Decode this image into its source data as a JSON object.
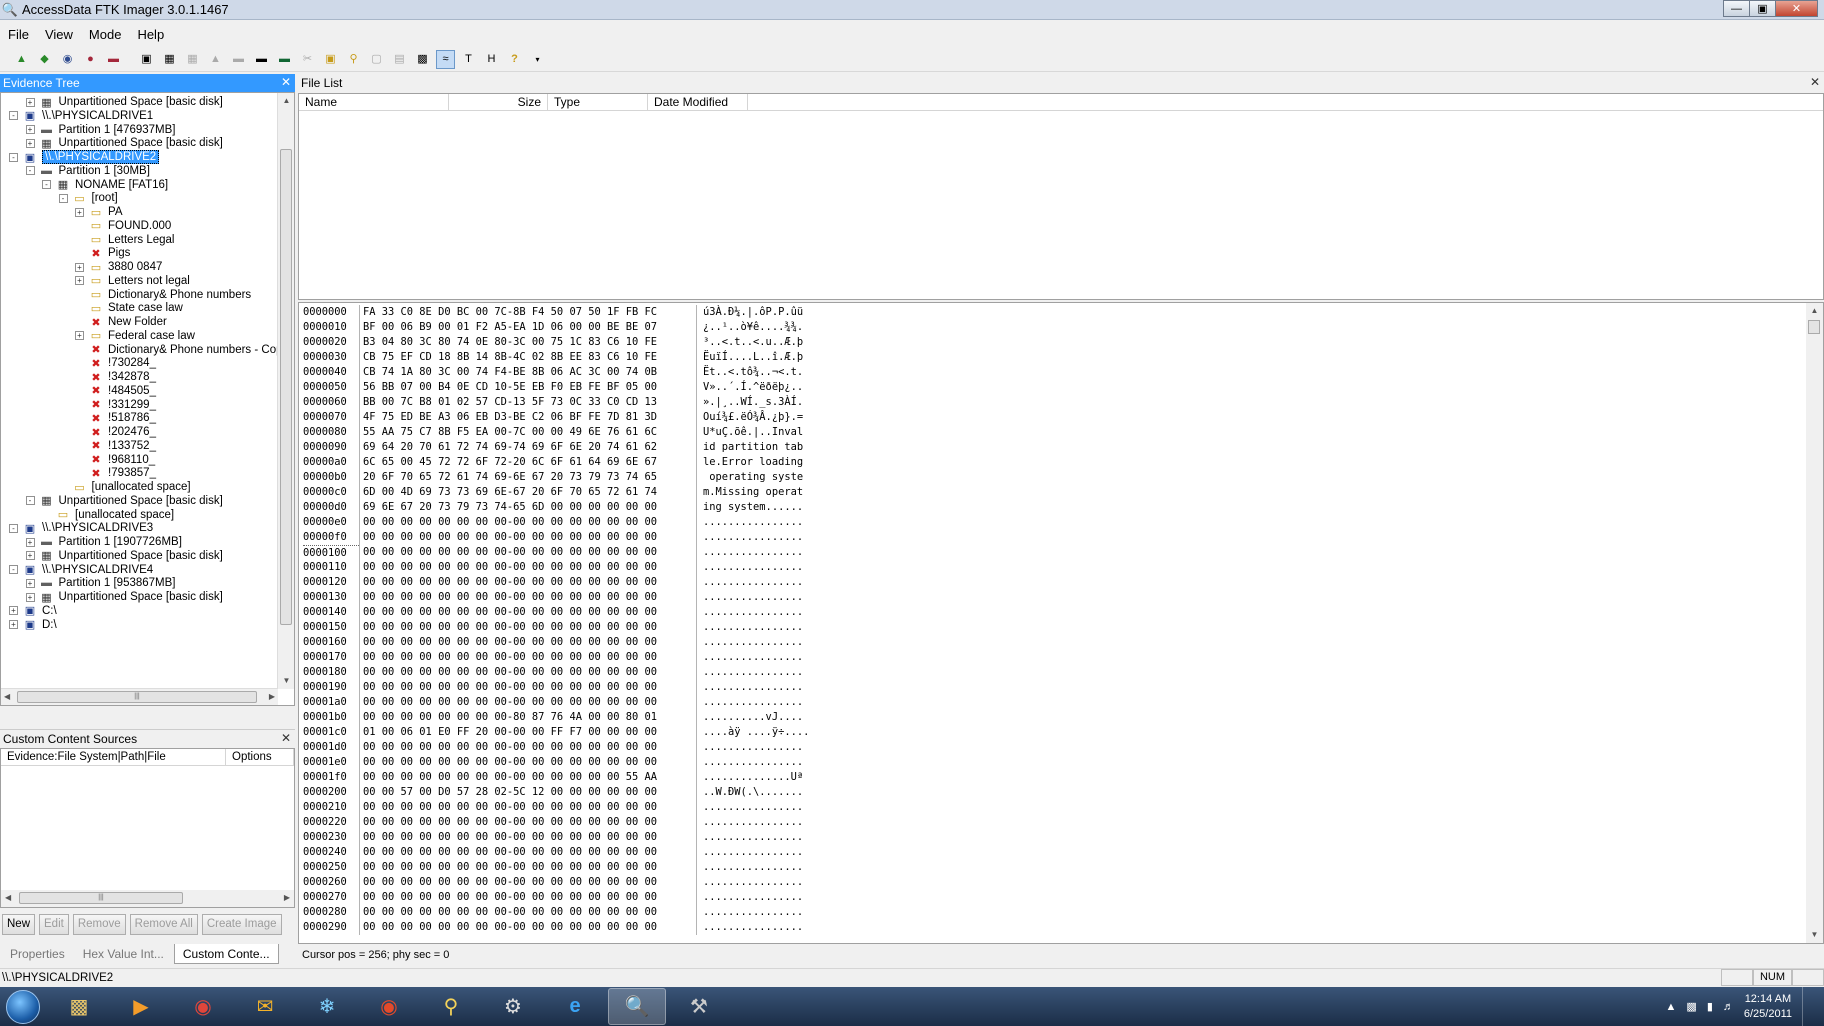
{
  "window": {
    "title": "AccessData FTK Imager 3.0.1.1467"
  },
  "menu": [
    "File",
    "View",
    "Mode",
    "Help"
  ],
  "panels": {
    "evidence_tree": "Evidence Tree",
    "file_list": "File List",
    "custom_content": "Custom Content Sources"
  },
  "tree": [
    {
      "level": 1,
      "exp": "+",
      "icon": "fs",
      "label": "Unpartitioned Space [basic disk]"
    },
    {
      "level": 0,
      "exp": "-",
      "icon": "drive",
      "label": "\\\\.\\PHYSICALDRIVE1"
    },
    {
      "level": 1,
      "exp": "+",
      "icon": "part",
      "label": "Partition 1 [476937MB]"
    },
    {
      "level": 1,
      "exp": "+",
      "icon": "fs",
      "label": "Unpartitioned Space [basic disk]"
    },
    {
      "level": 0,
      "exp": "-",
      "icon": "drive",
      "label": "\\\\.\\PHYSICALDRIVE2",
      "selected": true
    },
    {
      "level": 1,
      "exp": "-",
      "icon": "part",
      "label": "Partition 1 [30MB]"
    },
    {
      "level": 2,
      "exp": "-",
      "icon": "fs",
      "label": "NONAME [FAT16]"
    },
    {
      "level": 3,
      "exp": "-",
      "icon": "folder",
      "label": "[root]"
    },
    {
      "level": 4,
      "exp": "+",
      "icon": "folder",
      "label": "PA"
    },
    {
      "level": 4,
      "exp": "",
      "icon": "folder",
      "label": "FOUND.000"
    },
    {
      "level": 4,
      "exp": "",
      "icon": "folder",
      "label": "Letters Legal"
    },
    {
      "level": 4,
      "exp": "",
      "icon": "del",
      "label": "Pigs"
    },
    {
      "level": 4,
      "exp": "+",
      "icon": "folder",
      "label": "3880   0847"
    },
    {
      "level": 4,
      "exp": "+",
      "icon": "folder",
      "label": "Letters not legal"
    },
    {
      "level": 4,
      "exp": "",
      "icon": "folder",
      "label": "Dictionary& Phone numbers"
    },
    {
      "level": 4,
      "exp": "",
      "icon": "folder",
      "label": "State case law"
    },
    {
      "level": 4,
      "exp": "",
      "icon": "del",
      "label": "New Folder"
    },
    {
      "level": 4,
      "exp": "+",
      "icon": "folder",
      "label": "Federal case law"
    },
    {
      "level": 4,
      "exp": "",
      "icon": "del",
      "label": "Dictionary& Phone numbers - Copy"
    },
    {
      "level": 4,
      "exp": "",
      "icon": "del",
      "label": "!730284_"
    },
    {
      "level": 4,
      "exp": "",
      "icon": "del",
      "label": "!342878_"
    },
    {
      "level": 4,
      "exp": "",
      "icon": "del",
      "label": "!484505_"
    },
    {
      "level": 4,
      "exp": "",
      "icon": "del",
      "label": "!331299_"
    },
    {
      "level": 4,
      "exp": "",
      "icon": "del",
      "label": "!518786_"
    },
    {
      "level": 4,
      "exp": "",
      "icon": "del",
      "label": "!202476_"
    },
    {
      "level": 4,
      "exp": "",
      "icon": "del",
      "label": "!133752_"
    },
    {
      "level": 4,
      "exp": "",
      "icon": "del",
      "label": "!968110_"
    },
    {
      "level": 4,
      "exp": "",
      "icon": "del",
      "label": "!793857_"
    },
    {
      "level": 3,
      "exp": "",
      "icon": "folder",
      "label": "[unallocated space]"
    },
    {
      "level": 1,
      "exp": "-",
      "icon": "fs",
      "label": "Unpartitioned Space [basic disk]"
    },
    {
      "level": 2,
      "exp": "",
      "icon": "folder",
      "label": "[unallocated space]"
    },
    {
      "level": 0,
      "exp": "-",
      "icon": "drive",
      "label": "\\\\.\\PHYSICALDRIVE3"
    },
    {
      "level": 1,
      "exp": "+",
      "icon": "part",
      "label": "Partition 1 [1907726MB]"
    },
    {
      "level": 1,
      "exp": "+",
      "icon": "fs",
      "label": "Unpartitioned Space [basic disk]"
    },
    {
      "level": 0,
      "exp": "-",
      "icon": "drive",
      "label": "\\\\.\\PHYSICALDRIVE4"
    },
    {
      "level": 1,
      "exp": "+",
      "icon": "part",
      "label": "Partition 1 [953867MB]"
    },
    {
      "level": 1,
      "exp": "+",
      "icon": "fs",
      "label": "Unpartitioned Space [basic disk]"
    },
    {
      "level": 0,
      "exp": "+",
      "icon": "drive",
      "label": "C:\\"
    },
    {
      "level": 0,
      "exp": "+",
      "icon": "drive",
      "label": "D:\\"
    }
  ],
  "file_list_columns": [
    "Name",
    "Size",
    "Type",
    "Date Modified"
  ],
  "custom_content_columns": [
    "Evidence:File System|Path|File",
    "Options"
  ],
  "custom_buttons": [
    {
      "label": "New",
      "enabled": true
    },
    {
      "label": "Edit",
      "enabled": false
    },
    {
      "label": "Remove",
      "enabled": false
    },
    {
      "label": "Remove All",
      "enabled": false
    },
    {
      "label": "Create Image",
      "enabled": false
    }
  ],
  "bottom_tabs": [
    {
      "label": "Properties",
      "active": false
    },
    {
      "label": "Hex Value Int...",
      "active": false
    },
    {
      "label": "Custom Conte...",
      "active": true
    }
  ],
  "hex": [
    {
      "off": "0000000",
      "hex": "FA 33 C0 8E D0 BC 00 7C-8B F4 50 07 50 1F FB FC",
      "ascii": "ú3À.Ð¼.|.ôP.P.ûü"
    },
    {
      "off": "0000010",
      "hex": "BF 00 06 B9 00 01 F2 A5-EA 1D 06 00 00 BE BE 07",
      "ascii": "¿..¹..ò¥ê....¾¾."
    },
    {
      "off": "0000020",
      "hex": "B3 04 80 3C 80 74 0E 80-3C 00 75 1C 83 C6 10 FE",
      "ascii": "³..<.t..<.u..Æ.þ"
    },
    {
      "off": "0000030",
      "hex": "CB 75 EF CD 18 8B 14 8B-4C 02 8B EE 83 C6 10 FE",
      "ascii": "ËuïÍ....L..î.Æ.þ"
    },
    {
      "off": "0000040",
      "hex": "CB 74 1A 80 3C 00 74 F4-BE 8B 06 AC 3C 00 74 0B",
      "ascii": "Ët..<.tô¾..¬<.t."
    },
    {
      "off": "0000050",
      "hex": "56 BB 07 00 B4 0E CD 10-5E EB F0 EB FE BF 05 00",
      "ascii": "V»..´.Í.^ëðëþ¿.."
    },
    {
      "off": "0000060",
      "hex": "BB 00 7C B8 01 02 57 CD-13 5F 73 0C 33 C0 CD 13",
      "ascii": "».|¸..WÍ._s.3ÀÍ."
    },
    {
      "off": "0000070",
      "hex": "4F 75 ED BE A3 06 EB D3-BE C2 06 BF FE 7D 81 3D",
      "ascii": "Ouí¾£.ëÓ¾Â.¿þ}.="
    },
    {
      "off": "0000080",
      "hex": "55 AA 75 C7 8B F5 EA 00-7C 00 00 49 6E 76 61 6C",
      "ascii": "U*uÇ.õê.|..Inval"
    },
    {
      "off": "0000090",
      "hex": "69 64 20 70 61 72 74 69-74 69 6F 6E 20 74 61 62",
      "ascii": "id partition tab"
    },
    {
      "off": "00000a0",
      "hex": "6C 65 00 45 72 72 6F 72-20 6C 6F 61 64 69 6E 67",
      "ascii": "le.Error loading"
    },
    {
      "off": "00000b0",
      "hex": "20 6F 70 65 72 61 74 69-6E 67 20 73 79 73 74 65",
      "ascii": " operating syste"
    },
    {
      "off": "00000c0",
      "hex": "6D 00 4D 69 73 73 69 6E-67 20 6F 70 65 72 61 74",
      "ascii": "m.Missing operat"
    },
    {
      "off": "00000d0",
      "hex": "69 6E 67 20 73 79 73 74-65 6D 00 00 00 00 00 00",
      "ascii": "ing system......"
    },
    {
      "off": "00000e0",
      "hex": "00 00 00 00 00 00 00 00-00 00 00 00 00 00 00 00",
      "ascii": "................"
    },
    {
      "off": "00000f0",
      "hex": "00 00 00 00 00 00 00 00-00 00 00 00 00 00 00 00",
      "ascii": "................"
    },
    {
      "off": "0000100",
      "hex": "00 00 00 00 00 00 00 00-00 00 00 00 00 00 00 00",
      "ascii": "................"
    },
    {
      "off": "0000110",
      "hex": "00 00 00 00 00 00 00 00-00 00 00 00 00 00 00 00",
      "ascii": "................"
    },
    {
      "off": "0000120",
      "hex": "00 00 00 00 00 00 00 00-00 00 00 00 00 00 00 00",
      "ascii": "................"
    },
    {
      "off": "0000130",
      "hex": "00 00 00 00 00 00 00 00-00 00 00 00 00 00 00 00",
      "ascii": "................"
    },
    {
      "off": "0000140",
      "hex": "00 00 00 00 00 00 00 00-00 00 00 00 00 00 00 00",
      "ascii": "................"
    },
    {
      "off": "0000150",
      "hex": "00 00 00 00 00 00 00 00-00 00 00 00 00 00 00 00",
      "ascii": "................"
    },
    {
      "off": "0000160",
      "hex": "00 00 00 00 00 00 00 00-00 00 00 00 00 00 00 00",
      "ascii": "................"
    },
    {
      "off": "0000170",
      "hex": "00 00 00 00 00 00 00 00-00 00 00 00 00 00 00 00",
      "ascii": "................"
    },
    {
      "off": "0000180",
      "hex": "00 00 00 00 00 00 00 00-00 00 00 00 00 00 00 00",
      "ascii": "................"
    },
    {
      "off": "0000190",
      "hex": "00 00 00 00 00 00 00 00-00 00 00 00 00 00 00 00",
      "ascii": "................"
    },
    {
      "off": "00001a0",
      "hex": "00 00 00 00 00 00 00 00-00 00 00 00 00 00 00 00",
      "ascii": "................"
    },
    {
      "off": "00001b0",
      "hex": "00 00 00 00 00 00 00 00-80 87 76 4A 00 00 80 01",
      "ascii": "..........vJ...."
    },
    {
      "off": "00001c0",
      "hex": "01 00 06 01 E0 FF 20 00-00 00 FF F7 00 00 00 00",
      "ascii": "....àÿ ....ÿ÷...."
    },
    {
      "off": "00001d0",
      "hex": "00 00 00 00 00 00 00 00-00 00 00 00 00 00 00 00",
      "ascii": "................"
    },
    {
      "off": "00001e0",
      "hex": "00 00 00 00 00 00 00 00-00 00 00 00 00 00 00 00",
      "ascii": "................"
    },
    {
      "off": "00001f0",
      "hex": "00 00 00 00 00 00 00 00-00 00 00 00 00 00 55 AA",
      "ascii": "..............Uª"
    },
    {
      "off": "0000200",
      "hex": "00 00 57 00 D0 57 28 02-5C 12 00 00 00 00 00 00",
      "ascii": "..W.ÐW(.\\......."
    },
    {
      "off": "0000210",
      "hex": "00 00 00 00 00 00 00 00-00 00 00 00 00 00 00 00",
      "ascii": "................"
    },
    {
      "off": "0000220",
      "hex": "00 00 00 00 00 00 00 00-00 00 00 00 00 00 00 00",
      "ascii": "................"
    },
    {
      "off": "0000230",
      "hex": "00 00 00 00 00 00 00 00-00 00 00 00 00 00 00 00",
      "ascii": "................"
    },
    {
      "off": "0000240",
      "hex": "00 00 00 00 00 00 00 00-00 00 00 00 00 00 00 00",
      "ascii": "................"
    },
    {
      "off": "0000250",
      "hex": "00 00 00 00 00 00 00 00-00 00 00 00 00 00 00 00",
      "ascii": "................"
    },
    {
      "off": "0000260",
      "hex": "00 00 00 00 00 00 00 00-00 00 00 00 00 00 00 00",
      "ascii": "................"
    },
    {
      "off": "0000270",
      "hex": "00 00 00 00 00 00 00 00-00 00 00 00 00 00 00 00",
      "ascii": "................"
    },
    {
      "off": "0000280",
      "hex": "00 00 00 00 00 00 00 00-00 00 00 00 00 00 00 00",
      "ascii": "................"
    },
    {
      "off": "0000290",
      "hex": "00 00 00 00 00 00 00 00-00 00 00 00 00 00 00 00",
      "ascii": "................"
    }
  ],
  "hex_status": "Cursor pos = 256; phy sec = 0",
  "statusbar": {
    "path": "\\\\.\\PHYSICALDRIVE2",
    "num": "NUM"
  },
  "clock": {
    "time": "12:14 AM",
    "date": "6/25/2011"
  },
  "icons": {
    "toolbar": [
      "add-evidence-icon",
      "add-all-devices-icon",
      "create-image-icon",
      "export-disk-image-icon",
      "remove-evidence-icon",
      "capture-memory-icon",
      "save-icon",
      "export-files-icon",
      "export-hash-icon",
      "obtain-protected-files-icon",
      "detect-encryption-icon",
      "verify-drive-icon",
      "image-mount-icon",
      "auto-view-icon",
      "text-view-icon",
      "hex-view-icon",
      "help-icon"
    ]
  }
}
